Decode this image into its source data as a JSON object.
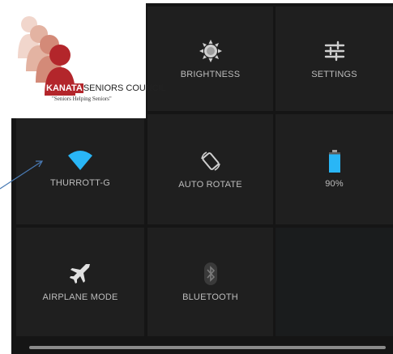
{
  "logo": {
    "org_name_highlight": "KANATA",
    "org_name_rest": "SENIORS COUNCIL",
    "tagline": "\"Seniors Helping Seniors\""
  },
  "tiles": [
    {
      "label": "BRIGHTNESS",
      "icon": "brightness-icon"
    },
    {
      "label": "SETTINGS",
      "icon": "settings-sliders-icon"
    },
    {
      "label": "THURROTT-G",
      "icon": "wifi-icon"
    },
    {
      "label": "AUTO ROTATE",
      "icon": "auto-rotate-icon"
    },
    {
      "label": "90%",
      "icon": "battery-icon"
    },
    {
      "label": "AIRPLANE MODE",
      "icon": "airplane-icon"
    },
    {
      "label": "BLUETOOTH",
      "icon": "bluetooth-icon"
    }
  ],
  "colors": {
    "wifi": "#29b6f6",
    "battery": "#29b6f6",
    "panel": "#151515",
    "tile": "#1f1f1f",
    "arrow": "#4a7bb5"
  },
  "battery": {
    "level": 0.9
  }
}
